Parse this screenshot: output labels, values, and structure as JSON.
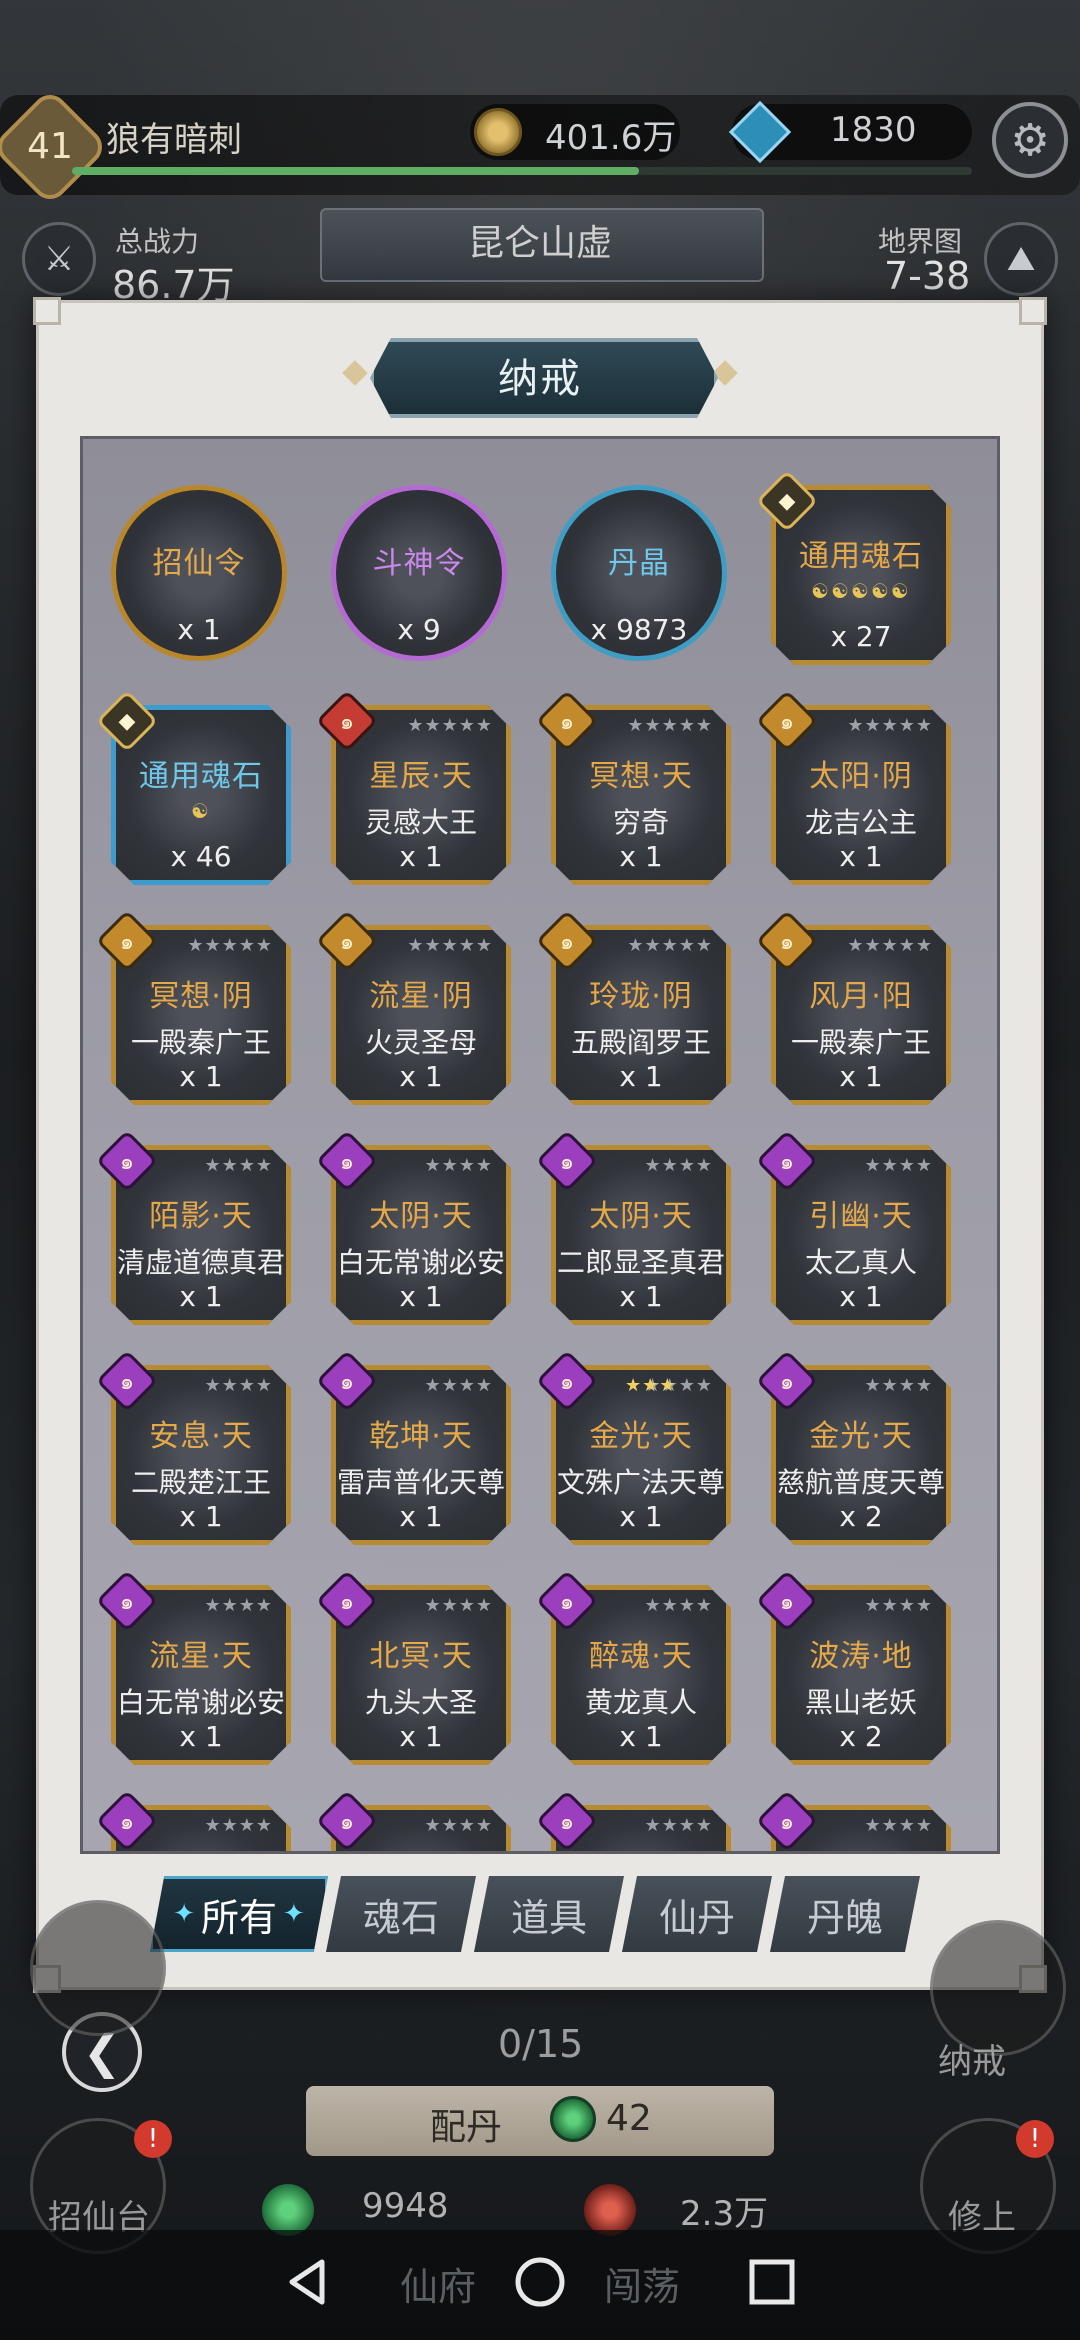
{
  "header": {
    "level": "41",
    "player_name": "狼有暗刺",
    "xp_progress": 0.63,
    "coins": "401.6万",
    "gems": "1830",
    "power_label": "总战力",
    "power_value": "86.7万",
    "region_name": "昆仑山虚",
    "map_label": "地界图",
    "map_value": "7-38"
  },
  "dialog": {
    "title": "纳戒"
  },
  "items": [
    {
      "type": "coin",
      "ring": "gold",
      "name": "招仙令",
      "name_color": "gold",
      "count": "x 1"
    },
    {
      "type": "coin",
      "ring": "purple",
      "name": "斗神令",
      "name_color": "purple",
      "count": "x 9"
    },
    {
      "type": "coin",
      "ring": "blue",
      "name": "丹晶",
      "name_color": "cyan",
      "count": "x 9873"
    },
    {
      "type": "tile",
      "border": "gold",
      "badge": "rank",
      "name": "通用魂石",
      "name_color": "gold",
      "sub": "☯☯☯☯☯",
      "count": "x 27"
    },
    {
      "type": "tile",
      "border": "blue",
      "badge": "rank",
      "name": "通用魂石",
      "name_color": "cyan",
      "sub": "☯",
      "count": "x 46"
    },
    {
      "type": "tile",
      "border": "gold",
      "badge": "red",
      "stars": "★★★★★",
      "name": "星辰·天",
      "name_color": "gold",
      "owner": "灵感大王",
      "count": "x 1"
    },
    {
      "type": "tile",
      "border": "gold",
      "badge": "gold",
      "stars": "★★★★★",
      "name": "冥想·天",
      "name_color": "gold",
      "owner": "穷奇",
      "count": "x 1"
    },
    {
      "type": "tile",
      "border": "gold",
      "badge": "gold",
      "stars": "★★★★★",
      "name": "太阳·阴",
      "name_color": "gold",
      "owner": "龙吉公主",
      "count": "x 1"
    },
    {
      "type": "tile",
      "border": "gold",
      "badge": "gold",
      "stars": "★★★★★",
      "name": "冥想·阴",
      "name_color": "gold",
      "owner": "一殿秦广王",
      "count": "x 1"
    },
    {
      "type": "tile",
      "border": "gold",
      "badge": "gold",
      "stars": "★★★★★",
      "name": "流星·阴",
      "name_color": "gold",
      "owner": "火灵圣母",
      "count": "x 1"
    },
    {
      "type": "tile",
      "border": "gold",
      "badge": "gold",
      "stars": "★★★★★",
      "name": "玲珑·阴",
      "name_color": "gold",
      "owner": "五殿阎罗王",
      "count": "x 1"
    },
    {
      "type": "tile",
      "border": "gold",
      "badge": "gold",
      "stars": "★★★★★",
      "name": "风月·阳",
      "name_color": "gold",
      "owner": "一殿秦广王",
      "count": "x 1"
    },
    {
      "type": "tile",
      "border": "gold",
      "badge": "purple",
      "stars": "★★★★",
      "name": "陌影·天",
      "name_color": "gold",
      "owner": "清虚道德真君",
      "count": "x 1"
    },
    {
      "type": "tile",
      "border": "gold",
      "badge": "purple",
      "stars": "★★★★",
      "name": "太阴·天",
      "name_color": "gold",
      "owner": "白无常谢必安",
      "count": "x 1"
    },
    {
      "type": "tile",
      "border": "gold",
      "badge": "purple",
      "stars": "★★★★",
      "name": "太阴·天",
      "name_color": "gold",
      "owner": "二郎显圣真君",
      "count": "x 1"
    },
    {
      "type": "tile",
      "border": "gold",
      "badge": "purple",
      "stars": "★★★★",
      "name": "引幽·天",
      "name_color": "gold",
      "owner": "太乙真人",
      "count": "x 1"
    },
    {
      "type": "tile",
      "border": "gold",
      "badge": "purple",
      "stars": "★★★★",
      "name": "安息·天",
      "name_color": "gold",
      "owner": "二殿楚江王",
      "count": "x 1"
    },
    {
      "type": "tile",
      "border": "gold",
      "badge": "purple",
      "stars": "★★★★",
      "name": "乾坤·天",
      "name_color": "gold",
      "owner": "雷声普化天尊",
      "count": "x 1"
    },
    {
      "type": "tile",
      "border": "gold",
      "badge": "purple",
      "stars": "★★★★",
      "stars_lit": "★★★",
      "name": "金光·天",
      "name_color": "gold",
      "owner": "文殊广法天尊",
      "count": "x 1"
    },
    {
      "type": "tile",
      "border": "gold",
      "badge": "purple",
      "stars": "★★★★",
      "name": "金光·天",
      "name_color": "gold",
      "owner": "慈航普度天尊",
      "count": "x 2"
    },
    {
      "type": "tile",
      "border": "gold",
      "badge": "purple",
      "stars": "★★★★",
      "name": "流星·天",
      "name_color": "gold",
      "owner": "白无常谢必安",
      "count": "x 1"
    },
    {
      "type": "tile",
      "border": "gold",
      "badge": "purple",
      "stars": "★★★★",
      "name": "北冥·天",
      "name_color": "gold",
      "owner": "九头大圣",
      "count": "x 1"
    },
    {
      "type": "tile",
      "border": "gold",
      "badge": "purple",
      "stars": "★★★★",
      "name": "醉魂·天",
      "name_color": "gold",
      "owner": "黄龙真人",
      "count": "x 1"
    },
    {
      "type": "tile",
      "border": "gold",
      "badge": "purple",
      "stars": "★★★★",
      "name": "波涛·地",
      "name_color": "gold",
      "owner": "黑山老妖",
      "count": "x 2"
    },
    {
      "type": "tile",
      "border": "gold",
      "badge": "purple",
      "stars": "★★★★",
      "name": "",
      "name_color": "gold",
      "owner": "",
      "count": ""
    },
    {
      "type": "tile",
      "border": "gold",
      "badge": "purple",
      "stars": "★★★★",
      "name": "",
      "name_color": "gold",
      "owner": "",
      "count": ""
    },
    {
      "type": "tile",
      "border": "gold",
      "badge": "purple",
      "stars": "★★★★",
      "name": "",
      "name_color": "gold",
      "owner": "",
      "count": ""
    },
    {
      "type": "tile",
      "border": "gold",
      "badge": "purple",
      "stars": "★★★★",
      "name": "",
      "name_color": "gold",
      "owner": "",
      "count": ""
    }
  ],
  "tabs": [
    "所有",
    "魂石",
    "道具",
    "仙丹",
    "丹魄"
  ],
  "active_tab": 0,
  "scene": {
    "progress": "0/15",
    "pill_label": "配丹",
    "pill_count": "42",
    "left_button": "招仙台",
    "right_button_top": "纳戒",
    "right_button": "修上",
    "notice_mark": "!",
    "res1": "9948",
    "res2": "2.3万",
    "nav_left": "仙府",
    "nav_right": "闯荡"
  },
  "icons": {
    "settings": "gear-icon",
    "back": "back-arrow-icon",
    "coin": "coin-icon",
    "gem": "diamond-icon"
  },
  "colors": {
    "gold_text": "#e6a94a",
    "purple_text": "#cb87ea",
    "cyan_text": "#6fc7ea",
    "tab_active_border": "#4aa7c9"
  }
}
